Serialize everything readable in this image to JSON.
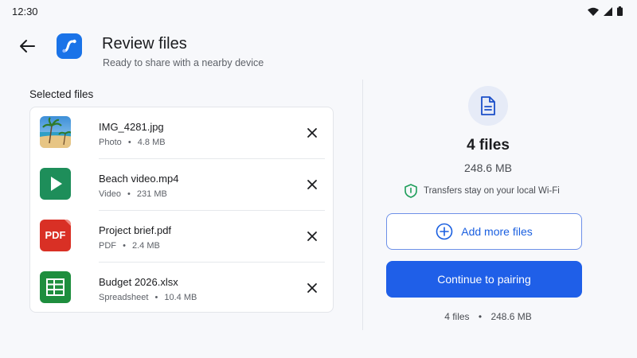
{
  "status": {
    "time": "12:30"
  },
  "header": {
    "title": "Review files",
    "subtitle": "Ready to share with a nearby device"
  },
  "files_section": {
    "label": "Selected files"
  },
  "files": [
    {
      "name": "IMG_4281.jpg",
      "type": "Photo",
      "size": "4.8 MB",
      "icon": "photo-thumbnail"
    },
    {
      "name": "Beach video.mp4",
      "type": "Video",
      "size": "231 MB",
      "icon": "video-icon"
    },
    {
      "name": "Project brief.pdf",
      "type": "PDF",
      "size": "2.4 MB",
      "icon": "pdf-icon",
      "icon_text": "PDF"
    },
    {
      "name": "Budget 2026.xlsx",
      "type": "Spreadsheet",
      "size": "10.4 MB",
      "icon": "spreadsheet-icon"
    }
  ],
  "separator": "•",
  "summary": {
    "count": "4 files",
    "size": "248.6 MB",
    "note": "Transfers stay on your local Wi-Fi"
  },
  "actions": {
    "add_label": "Add more files",
    "continue_label": "Continue to pairing"
  },
  "footer": {
    "count": "4 files",
    "size": "248.6 MB"
  },
  "colors": {
    "primary": "#1f5fe8",
    "video": "#1e8e5a",
    "pdf": "#d93025",
    "sheet": "#1e8e3e",
    "shield": "#1e9e5a"
  }
}
